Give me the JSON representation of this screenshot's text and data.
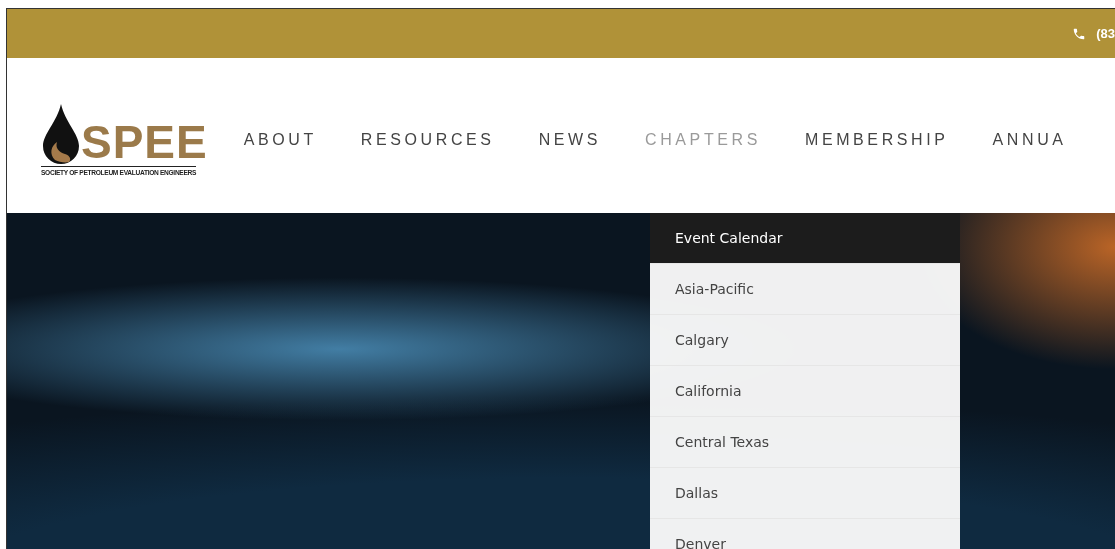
{
  "top_bar": {
    "phone": "(83"
  },
  "logo": {
    "name": "SPEE",
    "tagline": "SOCIETY OF PETROLEUM EVALUATION ENGINEERS"
  },
  "nav": [
    {
      "label": "ABOUT",
      "selected": false
    },
    {
      "label": "RESOURCES",
      "selected": false
    },
    {
      "label": "NEWS",
      "selected": false
    },
    {
      "label": "CHAPTERS",
      "selected": true
    },
    {
      "label": "MEMBERSHIP",
      "selected": false
    },
    {
      "label": "ANNUA",
      "selected": false
    }
  ],
  "dropdown": [
    {
      "label": "Event Calendar",
      "selected": true
    },
    {
      "label": "Asia-Pacific",
      "selected": false
    },
    {
      "label": "Calgary",
      "selected": false
    },
    {
      "label": "California",
      "selected": false
    },
    {
      "label": "Central Texas",
      "selected": false
    },
    {
      "label": "Dallas",
      "selected": false
    },
    {
      "label": "Denver",
      "selected": false
    }
  ]
}
